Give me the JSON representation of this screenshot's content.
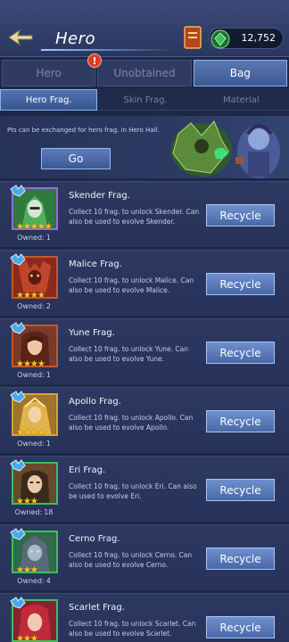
{
  "header": {
    "title": "Hero",
    "gems": "12,752"
  },
  "tabs": [
    {
      "label": "Hero",
      "active": false
    },
    {
      "label": "Unobtained",
      "active": false
    },
    {
      "label": "Bag",
      "active": true
    }
  ],
  "tab_alert": "!",
  "subtabs": [
    {
      "label": "Hero Frag.",
      "active": true
    },
    {
      "label": "Skin Frag.",
      "active": false
    },
    {
      "label": "Material",
      "active": false
    }
  ],
  "banner": {
    "text": "Pts can be exchanged for hero frag. in Hero Hall.",
    "go_label": "Go"
  },
  "items": [
    {
      "name": "Skender Frag.",
      "desc": "Collect 10 frag. to unlock Skender. Can also be used to evolve Skender.",
      "stars": "★★★★★",
      "owned_label": "Owned:",
      "owned": "1",
      "button": "Recycle",
      "color": "#2f7a3e"
    },
    {
      "name": "Malice Frag.",
      "desc": "Collect 10 frag. to unlock Malice. Can also be used to evolve Malice.",
      "stars": "★★★★",
      "owned_label": "Owned:",
      "owned": "2",
      "button": "Recycle",
      "color": "#8a2a1e"
    },
    {
      "name": "Yune Frag.",
      "desc": "Collect 10 frag. to unlock Yune. Can also be used to evolve Yune.",
      "stars": "★★★★",
      "owned_label": "Owned:",
      "owned": "1",
      "button": "Recycle",
      "color": "#7a3a2a"
    },
    {
      "name": "Apollo Frag.",
      "desc": "Collect 10 frag. to unlock Apollo. Can also be used to evolve Apollo.",
      "stars": "★★★★",
      "owned_label": "Owned:",
      "owned": "1",
      "button": "Recycle",
      "color": "#a0742a"
    },
    {
      "name": "Eri Frag.",
      "desc": "Collect 10 frag. to unlock Eri. Can also be used to evolve Eri.",
      "stars": "★★★",
      "owned_label": "Owned:",
      "owned": "18",
      "button": "Recycle",
      "color": "#6a4a2c"
    },
    {
      "name": "Cerno Frag.",
      "desc": "Collect 10 frag. to unlock Cerno. Can also be used to evolve Cerno.",
      "stars": "★★★",
      "owned_label": "Owned:",
      "owned": "4",
      "button": "Recycle",
      "color": "#2f6a4c"
    },
    {
      "name": "Scarlet Frag.",
      "desc": "Collect 10 frag. to unlock Scarlet. Can also be used to evolve Scarlet.",
      "stars": "★★★",
      "owned_label": "Owned:",
      "owned": "",
      "button": "Recycle",
      "color": "#8a2030"
    }
  ],
  "icons": {
    "back": "back-arrow-icon",
    "book": "book-icon",
    "gem": "gem-icon",
    "frag": "fragment-badge-icon"
  },
  "colors": {
    "accent": "#5b79b4",
    "star": "#ffc321",
    "alert": "#e03a2a",
    "gem": "#3fbf5a"
  }
}
